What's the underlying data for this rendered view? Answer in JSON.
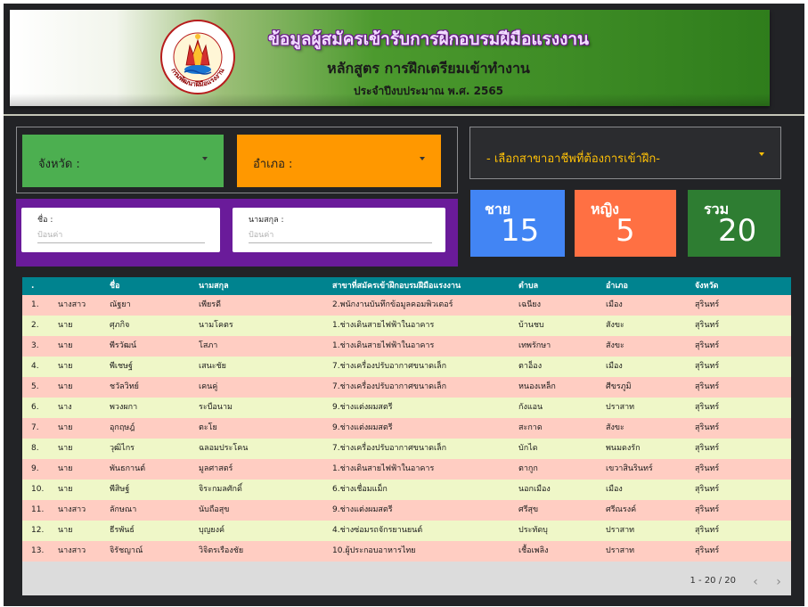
{
  "banner": {
    "title": "ข้อมูลผู้สมัครเข้ารับการฝึกอบรมฝีมือแรงงาน",
    "subtitle": "หลักสูตร การฝึกเตรียมเข้าทำงาน",
    "fiscal_year": "ประจำปีงบประมาณ พ.ศ. 2565",
    "logo_text": "กรมพัฒนาฝีมือแรงงาน"
  },
  "filters": {
    "province_label": "จังหวัด :",
    "district_label": "อำเภอ :",
    "branch_label": "- เลือกสาขาอาชีพที่ต้องการเข้าฝึก-"
  },
  "search": {
    "name_label": "ชื่อ :",
    "name_placeholder": "ป้อนค่า",
    "surname_label": "นามสกุล :",
    "surname_placeholder": "ป้อนค่า"
  },
  "stats": {
    "male_label": "ชาย",
    "male_value": "15",
    "female_label": "หญิง",
    "female_value": "5",
    "total_label": "รวม",
    "total_value": "20"
  },
  "table": {
    "headers": [
      ".",
      "",
      "ชื่อ",
      "นามสกุล",
      "สาขาที่สมัครเข้าฝึกอบรมฝีมือแรงงาน",
      "ตำบล",
      "อำเภอ",
      "จังหวัด"
    ],
    "rows": [
      [
        "1.",
        "นางสาว",
        "ณัฐยา",
        "เพียรดี",
        "2.พนักงานบันทึกข้อมูลคอมพิวเตอร์",
        "เฉนียง",
        "เมือง",
        "สุรินทร์"
      ],
      [
        "2.",
        "นาย",
        "ศุภกิจ",
        "นามโคตร",
        "1.ช่างเดินสายไฟฟ้าในอาคาร",
        "บ้านชบ",
        "สังขะ",
        "สุรินทร์"
      ],
      [
        "3.",
        "นาย",
        "พีรวัฒน์",
        "โสภา",
        "1.ช่างเดินสายไฟฟ้าในอาคาร",
        "เทพรักษา",
        "สังขะ",
        "สุรินทร์"
      ],
      [
        "4.",
        "นาย",
        "พีเชษฐ์",
        "เสนะชัย",
        "7.ช่างเครื่องปรับอากาศขนาดเล็ก",
        "ตาอ็อง",
        "เมือง",
        "สุรินทร์"
      ],
      [
        "5.",
        "นาย",
        "ชวัลวิทย์",
        "เคนคู่",
        "7.ช่างเครื่องปรับอากาศขนาดเล็ก",
        "หนองเหล็ก",
        "ศีขรภูมิ",
        "สุรินทร์"
      ],
      [
        "6.",
        "นาง",
        "พวงผกา",
        "ระบือนาม",
        "9.ช่างแต่งผมสตรี",
        "กังแอน",
        "ปราสาท",
        "สุรินทร์"
      ],
      [
        "7.",
        "นาย",
        "อุกฤษฎ์",
        "ตะโย",
        "9.ช่างแต่งผมสตรี",
        "สะกาด",
        "สังขะ",
        "สุรินทร์"
      ],
      [
        "8.",
        "นาย",
        "วุฒิไกร",
        "ฉลอมประโคน",
        "7.ช่างเครื่องปรับอากาศขนาดเล็ก",
        "บักได",
        "พนมดงรัก",
        "สุรินทร์"
      ],
      [
        "9.",
        "นาย",
        "พันธกานต์",
        "มูลศาสตร์",
        "1.ช่างเดินสายไฟฟ้าในอาคาร",
        "ตากูก",
        "เขวาสินรินทร์",
        "สุรินทร์"
      ],
      [
        "10.",
        "นาย",
        "พีสิษฐ์",
        "จิระกมลศักดิ์",
        "6.ช่างเชื่อมแม็ก",
        "นอกเมือง",
        "เมือง",
        "สุรินทร์"
      ],
      [
        "11.",
        "นางสาว",
        "ลักษณา",
        "นับถือสุข",
        "9.ช่างแต่งผมสตรี",
        "ศรีสุข",
        "ศรีณรงค์",
        "สุรินทร์"
      ],
      [
        "12.",
        "นาย",
        "ธีรพันธ์",
        "บุญยงค์",
        "4.ช่างซ่อมรถจักรยานยนต์",
        "ประทัดบุ",
        "ปราสาท",
        "สุรินทร์"
      ],
      [
        "13.",
        "นางสาว",
        "จิรัชญาณ์",
        "วิจิตรเรืองชัย",
        "10.ผู้ประกอบอาหารไทย",
        "เชื้อเพลิง",
        "ปราสาท",
        "สุรินทร์"
      ]
    ]
  },
  "pagination": {
    "info": "1 - 20 / 20",
    "prev": "‹",
    "next": "›"
  },
  "colors": {
    "province_bg": "#4caf50",
    "district_bg": "#ff9800",
    "branch_text": "#ffc107",
    "search_bg": "#6a1b9a",
    "male_bg": "#4285f4",
    "female_bg": "#ff7043",
    "total_bg": "#2e7d32",
    "table_header": "#00838f",
    "row_odd": "#ffcdc2",
    "row_even": "#eff7c8"
  }
}
